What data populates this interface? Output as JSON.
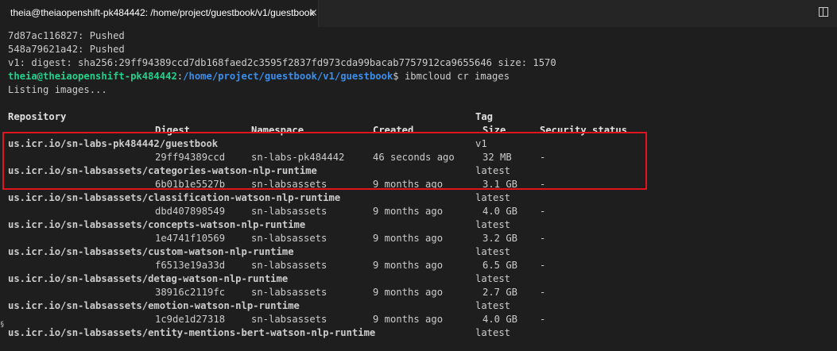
{
  "tab": {
    "title": "theia@theiaopenshift-pk484442: /home/project/guestbook/v1/guestbook",
    "close": "×"
  },
  "output": {
    "pushed1": "7d87ac116827: Pushed",
    "pushed2": "548a79621a42: Pushed",
    "digest": "v1: digest: sha256:29ff94389ccd7db168faed2c3595f2837fd973cda99bacab7757912ca9655646 size: 1570",
    "prompt_user": "theia@theiaopenshift-pk484442",
    "prompt_sep": ":",
    "prompt_path": "/home/project/guestbook/v1/guestbook",
    "prompt_end": "$ ibmcloud cr images",
    "listing": "Listing images..."
  },
  "table": {
    "headers": {
      "repository": "Repository",
      "tag": "Tag",
      "digest": "Digest",
      "namespace": "Namespace",
      "created": "Created",
      "size": "Size",
      "security": "Security status"
    },
    "rows": [
      {
        "repo": "us.icr.io/sn-labs-pk484442/guestbook",
        "tag": "v1",
        "digest": "29ff94389ccd",
        "namespace": "sn-labs-pk484442",
        "created": "46 seconds ago",
        "size": "32 MB",
        "security": "-"
      },
      {
        "repo": "us.icr.io/sn-labsassets/categories-watson-nlp-runtime",
        "tag": "latest",
        "digest": "6b01b1e5527b",
        "namespace": "sn-labsassets",
        "created": "9 months ago",
        "size": "3.1 GB",
        "security": "-"
      },
      {
        "repo": "us.icr.io/sn-labsassets/classification-watson-nlp-runtime",
        "tag": "latest",
        "digest": "dbd407898549",
        "namespace": "sn-labsassets",
        "created": "9 months ago",
        "size": "4.0 GB",
        "security": "-"
      },
      {
        "repo": "us.icr.io/sn-labsassets/concepts-watson-nlp-runtime",
        "tag": "latest",
        "digest": "1e4741f10569",
        "namespace": "sn-labsassets",
        "created": "9 months ago",
        "size": "3.2 GB",
        "security": "-"
      },
      {
        "repo": "us.icr.io/sn-labsassets/custom-watson-nlp-runtime",
        "tag": "latest",
        "digest": "f6513e19a33d",
        "namespace": "sn-labsassets",
        "created": "9 months ago",
        "size": "6.5 GB",
        "security": "-"
      },
      {
        "repo": "us.icr.io/sn-labsassets/detag-watson-nlp-runtime",
        "tag": "latest",
        "digest": "38916c2119fc",
        "namespace": "sn-labsassets",
        "created": "9 months ago",
        "size": "2.7 GB",
        "security": "-"
      },
      {
        "repo": "us.icr.io/sn-labsassets/emotion-watson-nlp-runtime",
        "tag": "latest",
        "digest": "1c9de1d27318",
        "namespace": "sn-labsassets",
        "created": "9 months ago",
        "size": "4.0 GB",
        "security": "-"
      },
      {
        "repo": "us.icr.io/sn-labsassets/entity-mentions-bert-watson-nlp-runtime",
        "tag": "latest"
      }
    ]
  },
  "edge_mark": "§",
  "colors": {
    "background": "#1e1e1e",
    "prompt_user": "#23d18b",
    "prompt_path": "#3b8eea",
    "repo": "#29b8db",
    "highlight": "#e0141e"
  },
  "icons": {
    "close": "close-icon",
    "split": "split-editor-icon"
  }
}
